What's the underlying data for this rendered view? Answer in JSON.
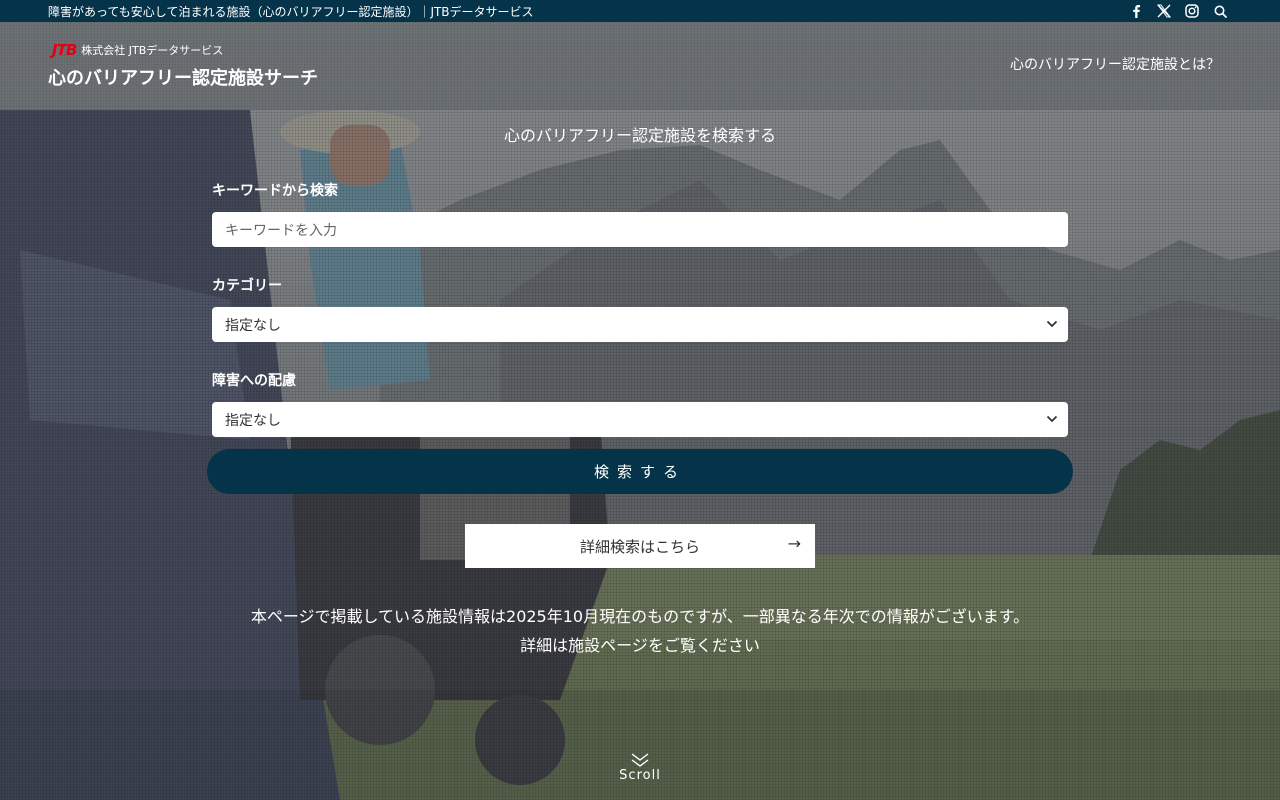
{
  "topbar": {
    "text": "障害があっても安心して泊まれる施設（心のバリアフリー認定施設）｜JTBデータサービス",
    "icons": [
      "facebook-icon",
      "x-icon",
      "instagram-icon",
      "search-icon"
    ]
  },
  "header": {
    "logo_mark": "JTB",
    "logo_company": "株式会社 JTBデータサービス",
    "site_title": "心のバリアフリー認定施設サーチ",
    "about_link": "心のバリアフリー認定施設とは？"
  },
  "search": {
    "heading": "心のバリアフリー認定施設を検索する",
    "keyword_label": "キーワードから検索",
    "keyword_placeholder": "キーワードを入力",
    "category_label": "カテゴリー",
    "category_value": "指定なし",
    "consideration_label": "障害への配慮",
    "consideration_value": "指定なし",
    "submit_label": "検索する",
    "detail_label": "詳細検索はこちら",
    "detail_arrow": "→"
  },
  "notice": {
    "line1": "本ページで掲載している施設情報は2025年10月現在のものですが、一部異なる年次での情報がございます。",
    "line2": "詳細は施設ページをご覧ください"
  },
  "scroll_label": "Scroll",
  "colors": {
    "navy": "#05334a",
    "jtb_red": "#e60012"
  }
}
